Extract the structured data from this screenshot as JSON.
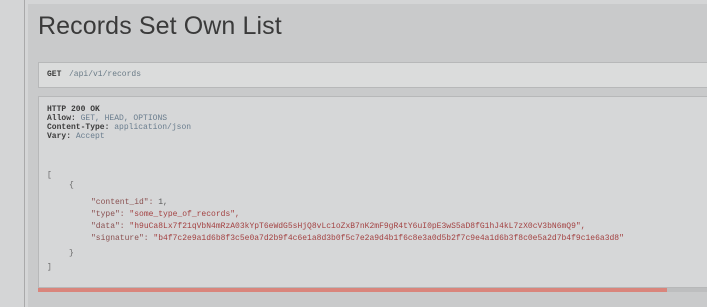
{
  "page": {
    "title": "Records Set Own List"
  },
  "request": {
    "method": "GET",
    "url": "/api/v1/records"
  },
  "response": {
    "status": "HTTP 200 OK",
    "headers": [
      {
        "name": "Allow:",
        "value": "GET, HEAD, OPTIONS"
      },
      {
        "name": "Content-Type:",
        "value": "application/json"
      },
      {
        "name": "Vary:",
        "value": "Accept"
      }
    ],
    "body": {
      "open_bracket": "[",
      "open_brace": "{",
      "fields": [
        {
          "key": "\"content_id\":",
          "value": "1,",
          "kind": "num"
        },
        {
          "key": "\"type\":",
          "value": "\"some_type_of_records\",",
          "kind": "str"
        },
        {
          "key": "\"data\":",
          "value": "\"h9uCa8Lx7f21qVbN4mRzA03kYpT6eWdG5sHjQ8vLc1oZxB7nK2mF9gR4tY6uI0pE3wS5aD8fG1hJ4kL7zX0cV3bN6mQ9\",",
          "kind": "str"
        },
        {
          "key": "\"signature\":",
          "value": "\"b4f7c2e9a1d6b8f3c5e0a7d2b9f4c6e1a8d3b0f5c7e2a9d4b1f6c8e3a0d5b2f7c9e4a1d6b3f8c0e5a2d7b4f9c1e6a3d8\"",
          "kind": "str"
        }
      ],
      "close_brace": "}",
      "close_bracket": "]"
    }
  },
  "scroll": {
    "fraction": 0.94,
    "color": "#d9857c"
  }
}
